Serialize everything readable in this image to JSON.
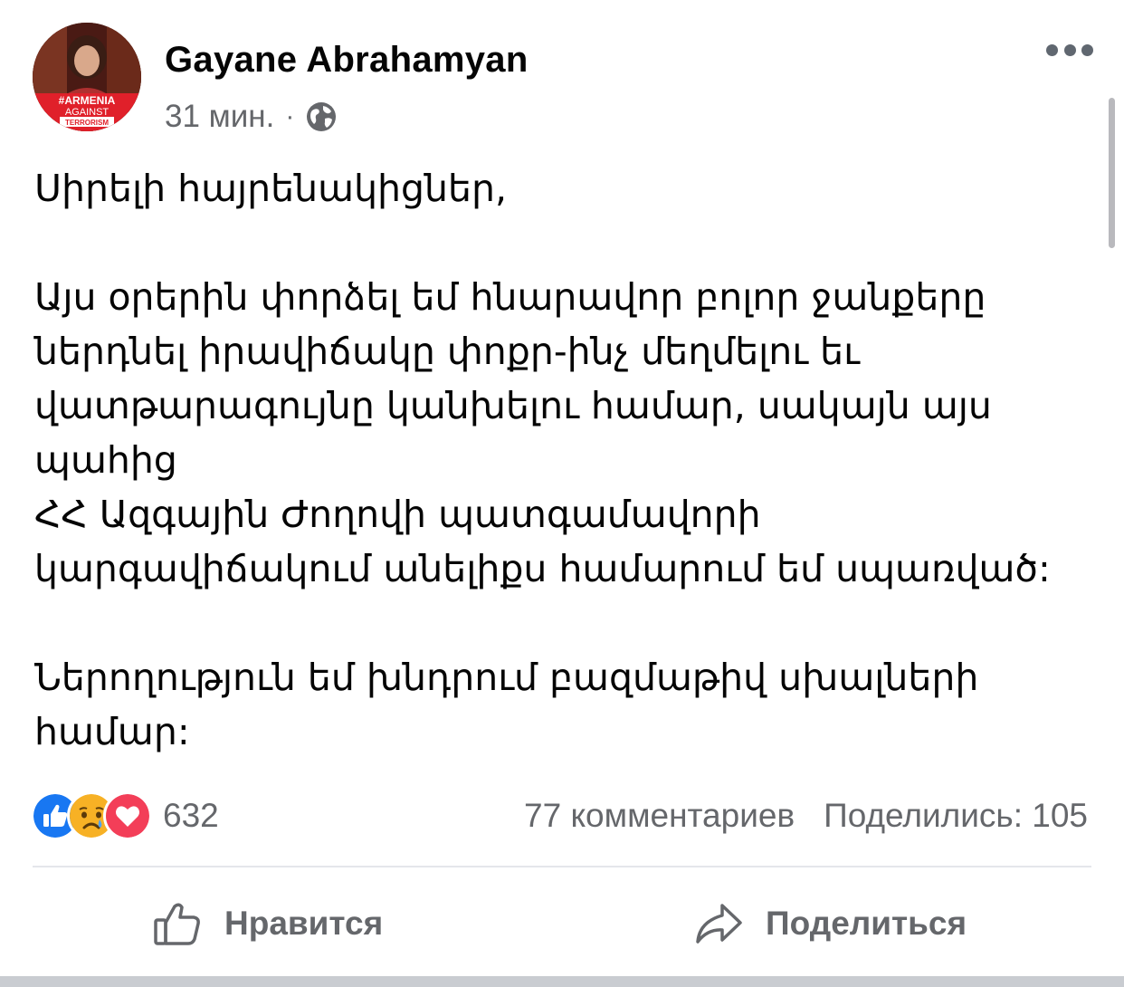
{
  "post": {
    "author": "Gayane Abrahamyan",
    "time": "31 мин.",
    "separator": "·",
    "privacy_icon": "globe-icon",
    "avatar_badge": [
      "#ARMENIA",
      "AGAINST",
      "TERRORISM"
    ],
    "body": {
      "greeting": "Սիրելի հայրենակիցներ,",
      "p2_lines": [
        "Այս օրերին փորձել եմ հնարավոր բոլոր ջանքերը",
        "ներդնել իրավիճակը փոքր-ինչ մեղմելու եւ",
        "վատթարագույնը կանխելու համար, սակայն այս",
        "պահից",
        "ՀՀ Ազգային Ժողովի պատգամավորի",
        "կարգավիճակում անելիքս համարում եմ սպառված:"
      ],
      "p3_lines": [
        "Ներողություն եմ խնդրում բազմաթիվ սխալների",
        "համար:"
      ]
    }
  },
  "reactions": {
    "icons": [
      "like-reaction-icon",
      "sad-reaction-icon",
      "love-reaction-icon"
    ],
    "count": "632"
  },
  "stats": {
    "comments": "77 комментариев",
    "shares": "Поделились: 105"
  },
  "actions": {
    "like_label": "Нравится",
    "share_label": "Поделиться"
  },
  "colors": {
    "secondary_text": "#65676b",
    "like_blue": "#1877f2",
    "love_red": "#f33e58",
    "sad_yellow": "#f7b125",
    "avatar_badge_red": "#e0202a"
  }
}
